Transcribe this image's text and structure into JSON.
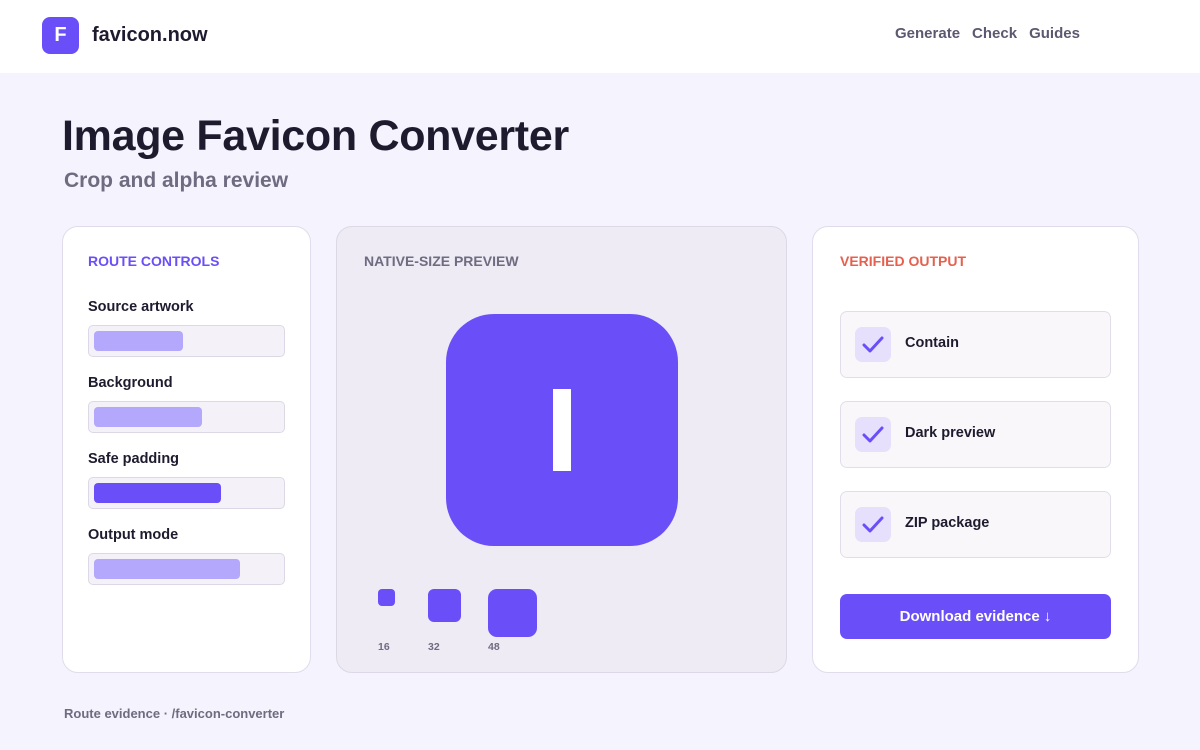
{
  "brand": {
    "logo_letter": "F",
    "name": "favicon.now"
  },
  "nav": [
    "Generate",
    "Check",
    "Guides"
  ],
  "page": {
    "title": "Image Favicon Converter",
    "subtitle": "Crop and alpha review"
  },
  "route_controls": {
    "heading": "ROUTE CONTROLS",
    "controls": [
      {
        "label": "Source artwork",
        "level": 0.45
      },
      {
        "label": "Background",
        "level": 0.55
      },
      {
        "label": "Safe padding",
        "level": 0.65
      },
      {
        "label": "Output mode",
        "level": 0.75
      }
    ]
  },
  "preview": {
    "heading": "NATIVE-SIZE PREVIEW",
    "icon_glyph": "I",
    "sizes": [
      "16",
      "32",
      "48"
    ]
  },
  "verified_output": {
    "heading": "VERIFIED OUTPUT",
    "items": [
      "Contain",
      "Dark preview",
      "ZIP package"
    ],
    "download_label": "Download evidence ↓"
  },
  "footer": "Route evidence · /favicon-converter",
  "colors": {
    "accent": "#6a4ff8",
    "accent_light": "#b3a8fb",
    "verified_heading": "#e5604e",
    "background": "#f5f3fd"
  }
}
